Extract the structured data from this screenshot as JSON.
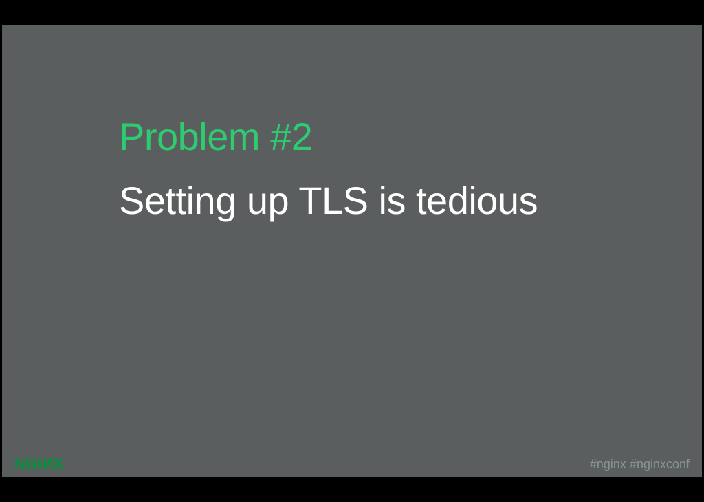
{
  "slide": {
    "heading": "Problem #2",
    "subheading": "Setting up TLS is tedious"
  },
  "footer": {
    "logo_text": "NGINX",
    "hashtags": "#nginx  #nginxconf"
  },
  "colors": {
    "accent": "#2ecc71",
    "brand": "#009639",
    "slide_bg": "#5a5e5e",
    "page_bg": "#000000",
    "text": "#ffffff",
    "muted": "#8a9494"
  }
}
